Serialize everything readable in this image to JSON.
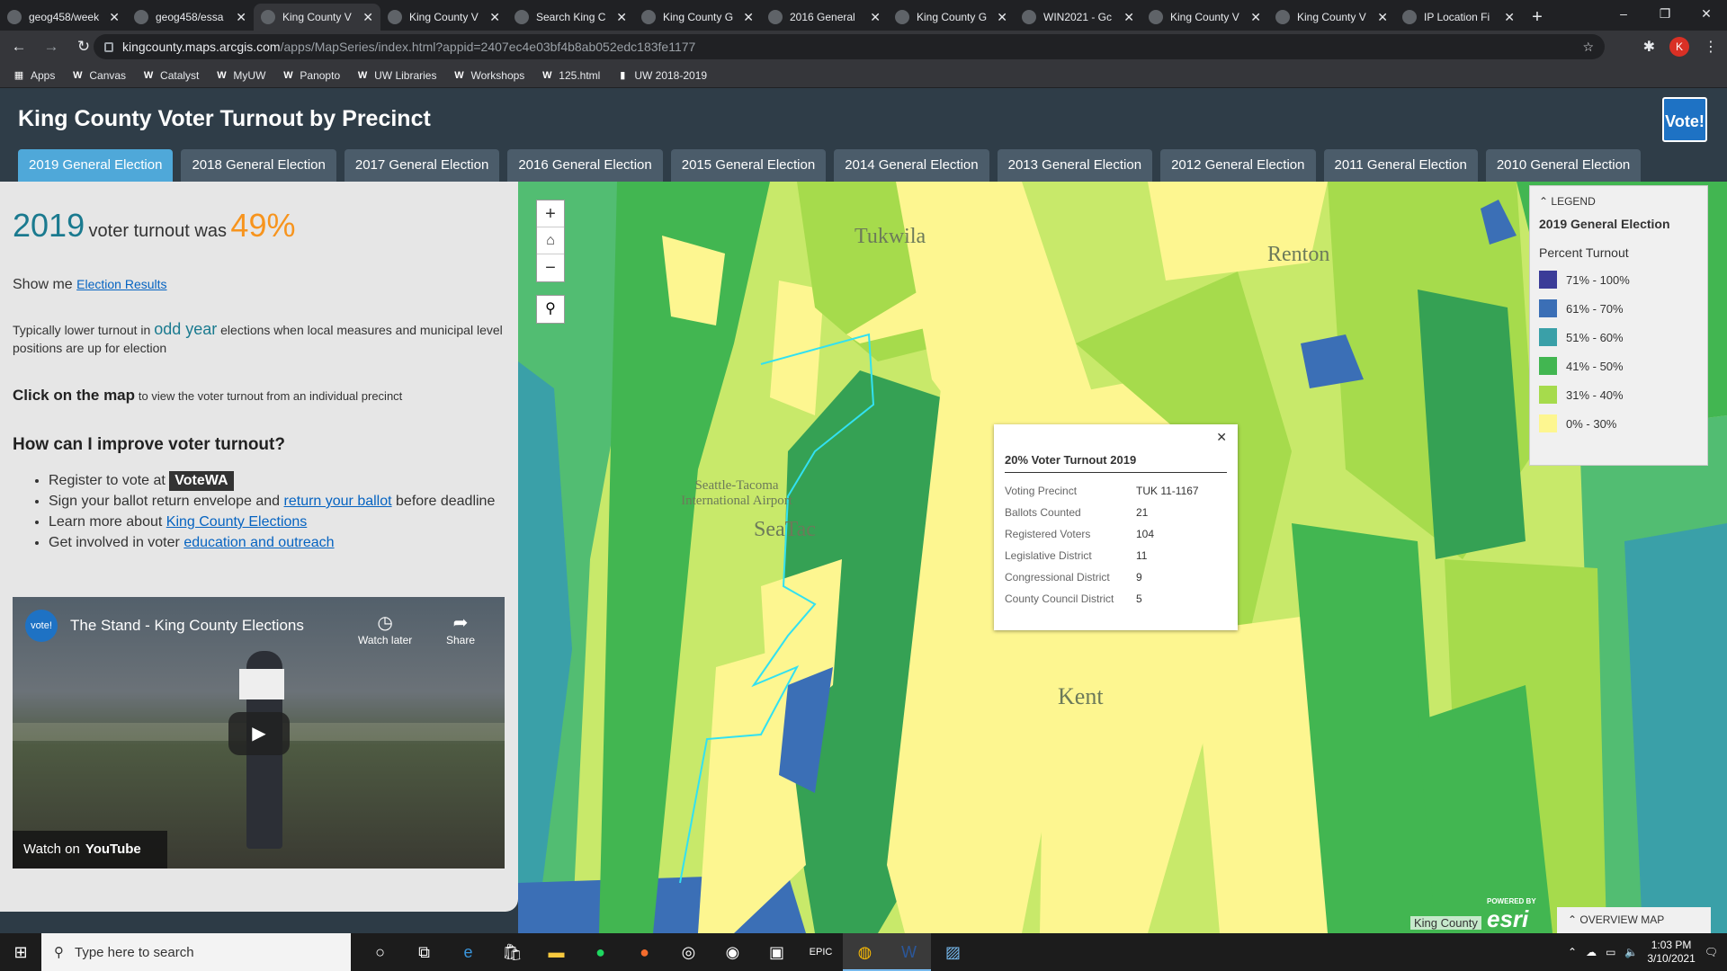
{
  "browser": {
    "tabs": [
      {
        "label": "geog458/week",
        "active": false
      },
      {
        "label": "geog458/essa",
        "active": false
      },
      {
        "label": "King County V",
        "active": true
      },
      {
        "label": "King County V",
        "active": false
      },
      {
        "label": "Search King C",
        "active": false
      },
      {
        "label": "King County G",
        "active": false
      },
      {
        "label": "2016 General",
        "active": false
      },
      {
        "label": "King County G",
        "active": false
      },
      {
        "label": "WIN2021 - Gc",
        "active": false
      },
      {
        "label": "King County V",
        "active": false
      },
      {
        "label": "King County V",
        "active": false
      },
      {
        "label": "IP Location Fi",
        "active": false
      }
    ],
    "url_host": "kingcounty.maps.arcgis.com",
    "url_path": "/apps/MapSeries/index.html?appid=2407ec4e03bf4b8ab052edc183fe1177",
    "profile_initial": "K",
    "bookmarks": [
      "Apps",
      "Canvas",
      "Catalyst",
      "MyUW",
      "Panopto",
      "UW Libraries",
      "Workshops",
      "125.html",
      "UW 2018-2019"
    ]
  },
  "app": {
    "title": "King County Voter Turnout by Precinct",
    "logo_text": "Vote!",
    "tabs": [
      "2019 General Election",
      "2018 General Election",
      "2017 General Election",
      "2016 General Election",
      "2015 General Election",
      "2014 General Election",
      "2013 General Election",
      "2012 General Election",
      "2011 General Election",
      "2010 General Election"
    ]
  },
  "panel": {
    "year": "2019",
    "turnout_mid": "voter turnout was",
    "turnout_pct": "49%",
    "show_me": "Show me",
    "election_results": "Election Results",
    "odd_text_1": "Typically lower turnout in",
    "odd_year": "odd year",
    "odd_text_2": "elections when local measures and municipal level positions are up for election",
    "click_bold": "Click on the map",
    "click_rest": "to view the voter turnout from an individual precinct",
    "improve_heading": "How can I improve voter turnout?",
    "b1": "Register to vote at",
    "votewa": "VoteWA",
    "b2a": "Sign your ballot return envelope and",
    "b2link": "return your ballot",
    "b2b": "before deadline",
    "b3a": "Learn more about",
    "b3link": "King County Elections",
    "b4a": "Get involved in voter",
    "b4link": "education and outreach",
    "video_title": "The Stand - King County Elections",
    "watch_later": "Watch later",
    "share": "Share",
    "watch_on": "Watch on",
    "youtube": "YouTube",
    "video_icon": "vote!"
  },
  "map": {
    "labels": [
      "Tukwila",
      "Renton",
      "SeaTac",
      "Kent",
      "Seattle-Tacoma International Airport"
    ],
    "popup": {
      "title": "20% Voter Turnout 2019",
      "rows": [
        {
          "k": "Voting Precinct",
          "v": "TUK 11-1167"
        },
        {
          "k": "Ballots Counted",
          "v": "21"
        },
        {
          "k": "Registered Voters",
          "v": "104"
        },
        {
          "k": "Legislative District",
          "v": "11"
        },
        {
          "k": "Congressional District",
          "v": "9"
        },
        {
          "k": "County Council District",
          "v": "5"
        }
      ]
    },
    "legend": {
      "header": "LEGEND",
      "subtitle": "2019 General Election",
      "field": "Percent Turnout",
      "classes": [
        {
          "label": "71% - 100%",
          "color": "#3b3c98"
        },
        {
          "label": "61% - 70%",
          "color": "#3b6fb6"
        },
        {
          "label": "51% - 60%",
          "color": "#3aa0a8"
        },
        {
          "label": "41% - 50%",
          "color": "#42b651"
        },
        {
          "label": "31% - 40%",
          "color": "#a6db4c"
        },
        {
          "label": "0% - 30%",
          "color": "#fdf690"
        }
      ]
    },
    "overview": "OVERVIEW MAP",
    "attribution": "King County",
    "esri_powered": "POWERED BY",
    "esri": "esri"
  },
  "taskbar": {
    "search_placeholder": "Type here to search",
    "time": "1:03 PM",
    "date": "3/10/2021"
  }
}
